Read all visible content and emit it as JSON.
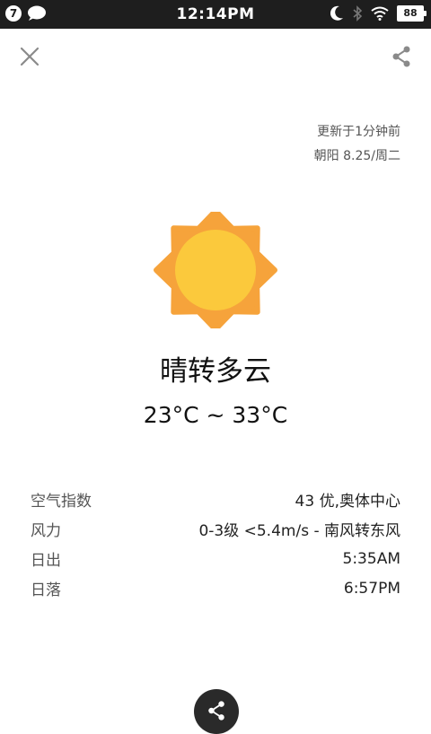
{
  "status_bar": {
    "notification_count": "7",
    "time": "12:14PM",
    "battery": "88",
    "icons": [
      "message-bubble-icon",
      "moon-icon",
      "bluetooth-icon",
      "wifi-icon",
      "battery-icon"
    ]
  },
  "header": {
    "close_icon": "close-icon",
    "share_icon": "share-icon"
  },
  "update": {
    "updated": "更新于1分钟前",
    "location_date": "朝阳  8.25/周二"
  },
  "weather": {
    "icon": "sun-icon",
    "condition": "晴转多云",
    "temperature": "23°C ~ 33°C",
    "colors": {
      "sun_outer": "#f6a33b",
      "sun_inner": "#fbc93c"
    }
  },
  "details": [
    {
      "label": "空气指数",
      "value": "43 优,奥体中心"
    },
    {
      "label": "风力",
      "value": "0-3级 <5.4m/s - 南风转东风"
    },
    {
      "label": "日出",
      "value": "5:35AM"
    },
    {
      "label": "日落",
      "value": "6:57PM"
    }
  ],
  "footer": {
    "share_icon": "share-icon"
  }
}
